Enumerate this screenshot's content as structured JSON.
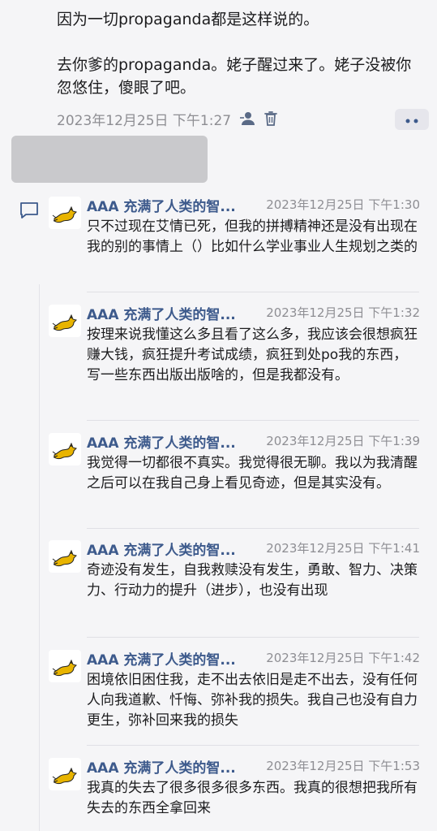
{
  "post": {
    "lines": [
      "因为一切propaganda都是这样说的。",
      "去你爹的propaganda。姥子醒过来了。姥子没被你忽悠住，傻眼了吧。"
    ],
    "timestamp": "2023年12月25日 下午1:27",
    "icons": [
      "person-icon",
      "trash-icon",
      "more-icon"
    ]
  },
  "comments": [
    {
      "author": "AAA 充满了人类的智...",
      "time": "2023年12月25日 下午1:30",
      "text": "只不过现在艾情已死，但我的拼搏精神还是没有出现在我的别的事情上（）比如什么学业事业人生规划之类的"
    },
    {
      "author": "AAA 充满了人类的智...",
      "time": "2023年12月25日 下午1:32",
      "text": "按理来说我懂这么多且看了这么多，我应该会很想疯狂赚大钱，疯狂提升考试成绩，疯狂到处po我的东西，写一些东西出版出版啥的，但是我都没有。"
    },
    {
      "author": "AAA 充满了人类的智...",
      "time": "2023年12月25日 下午1:39",
      "text": "我觉得一切都很不真实。我觉得很无聊。我以为我清醒之后可以在我自己身上看见奇迹，但是其实没有。"
    },
    {
      "author": "AAA 充满了人类的智...",
      "time": "2023年12月25日 下午1:41",
      "text": "奇迹没有发生，自我救赎没有发生，勇敢、智力、决策力、行动力的提升（进步），也没有出现"
    },
    {
      "author": "AAA 充满了人类的智...",
      "time": "2023年12月25日 下午1:42",
      "text": "困境依旧困住我，走不出去依旧是走不出去，没有任何人向我道歉、忏悔、弥补我的损失。我自己也没有自力更生，弥补回来我的损失"
    },
    {
      "author": "AAA 充满了人类的智...",
      "time": "2023年12月25日 下午1:53",
      "text": "我真的失去了很多很多很多东西。我真的很想把我所有失去的东西全拿回来"
    }
  ],
  "colors": {
    "author": "#3d5a8c",
    "muted": "#8e8e93",
    "background": "#f5f5f7"
  }
}
